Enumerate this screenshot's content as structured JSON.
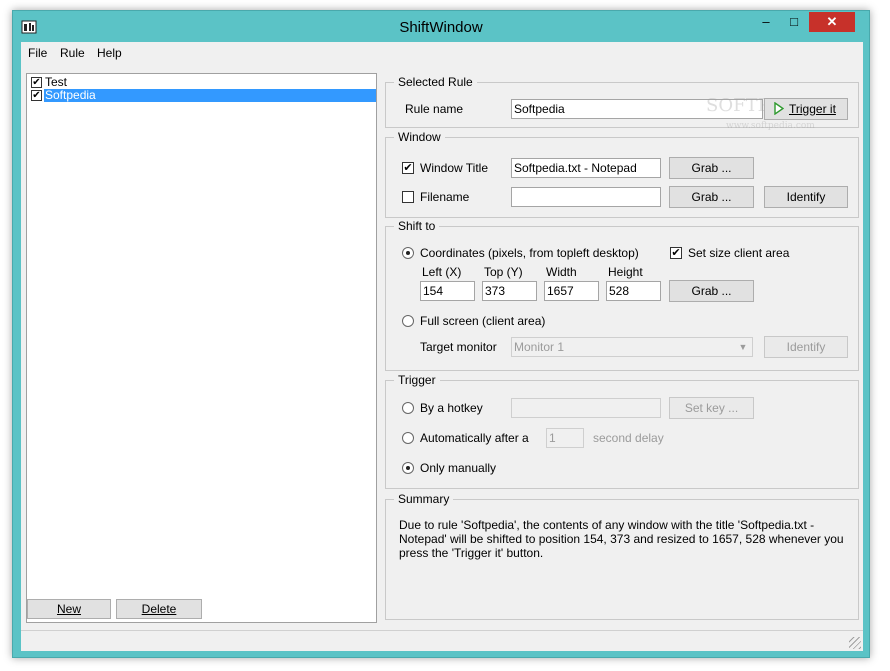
{
  "window": {
    "title": "ShiftWindow",
    "minimize": "–",
    "maximize": "□",
    "close": "✕"
  },
  "menu": {
    "file": "File",
    "rule": "Rule",
    "help": "Help"
  },
  "rules": [
    {
      "label": "Test",
      "checked": true
    },
    {
      "label": "Softpedia",
      "checked": true,
      "selected": true
    }
  ],
  "buttons": {
    "new": "New",
    "delete": "Delete"
  },
  "selected_rule": {
    "group": "Selected Rule",
    "rule_name_label": "Rule name",
    "rule_name_value": "Softpedia",
    "trigger_button": "Trigger it"
  },
  "window_group": {
    "group": "Window",
    "window_title_label": "Window Title",
    "window_title_checked": true,
    "window_title_value": "Softpedia.txt - Notepad",
    "grab": "Grab ...",
    "filename_label": "Filename",
    "filename_checked": false,
    "filename_value": "",
    "identify": "Identify"
  },
  "shift_to": {
    "group": "Shift to",
    "coordinates_label": "Coordinates (pixels, from topleft desktop)",
    "set_size_label": "Set size client area",
    "left_label": "Left (X)",
    "top_label": "Top (Y)",
    "width_label": "Width",
    "height_label": "Height",
    "left_value": "154",
    "top_value": "373",
    "width_value": "1657",
    "height_value": "528",
    "grab": "Grab ...",
    "fullscreen_label": "Full screen (client area)",
    "target_monitor_label": "Target monitor",
    "target_monitor_value": "Monitor 1",
    "identify": "Identify"
  },
  "trigger": {
    "group": "Trigger",
    "hotkey_label": "By a hotkey",
    "hotkey_value": "",
    "set_key": "Set key ...",
    "auto_label": "Automatically after a",
    "auto_value": "1",
    "delay_suffix": "second delay",
    "manual_label": "Only manually",
    "selected": "manual"
  },
  "summary": {
    "group": "Summary",
    "text": "Due to rule 'Softpedia', the contents of any window with the title 'Softpedia.txt - Notepad' will be shifted to position 154, 373 and resized to 1657, 528 whenever you press the 'Trigger it' button."
  },
  "watermark": {
    "brand": "SOFTPEDIA",
    "url": "www.softpedia.com"
  },
  "icons": {
    "app": "app-icon",
    "trigger": "play-arrow-icon",
    "checkmark": "✔",
    "combo": "▼"
  }
}
